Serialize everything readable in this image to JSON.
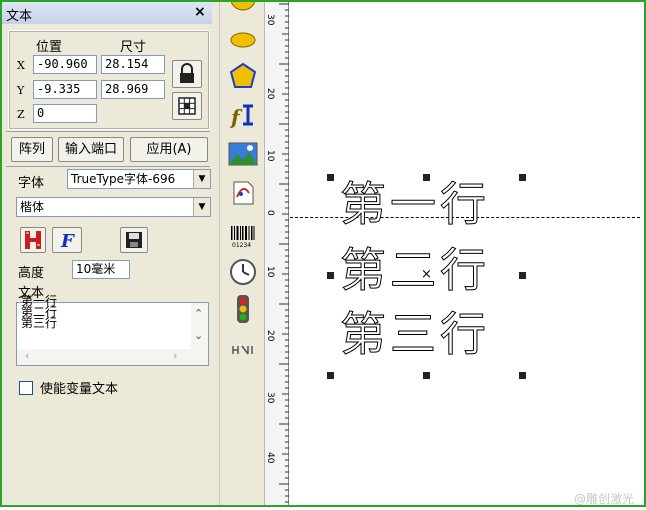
{
  "panel": {
    "title": "文本",
    "close_glyph": "×",
    "position_label": "位置",
    "size_label": "尺寸",
    "x_label": "X",
    "y_label": "Y",
    "z_label": "Z",
    "x_value": "-90.960",
    "y_value": "-9.335",
    "z_value": "0",
    "width_value": "28.154",
    "height_value": "28.969",
    "array_button": "阵列",
    "input_port_button": "输入端口",
    "apply_button": "应用(A)",
    "font_label": "字体",
    "font_type_value": "TrueType字体-696",
    "font_name_value": "楷体",
    "height_label": "高度",
    "text_height_value": "10毫米",
    "text_label": "文本",
    "text_lines": [
      "第一行",
      "第二行",
      "第三行"
    ],
    "variable_text_label": "使能变量文本",
    "variable_text_checked": false
  },
  "canvas": {
    "lines": [
      "第一行",
      "第二行",
      "第三行"
    ]
  },
  "ruler": {
    "labels": [
      "30",
      "20",
      "10",
      "0",
      "10",
      "20",
      "30",
      "40"
    ]
  },
  "watermark": "@雕创激光",
  "icons": [
    "circle-icon",
    "ellipse-icon",
    "polygon-icon",
    "text-tool-icon",
    "image-icon",
    "vector-file-icon",
    "barcode-icon",
    "timer-icon",
    "traffic-light-icon",
    "extension-icon"
  ],
  "barcode_digits": "01234",
  "colors": {
    "frame": "#2aa52a",
    "panel": "#ece9d8",
    "accent_blue": "#1030c0",
    "hatch_red": "#c81e1e"
  }
}
